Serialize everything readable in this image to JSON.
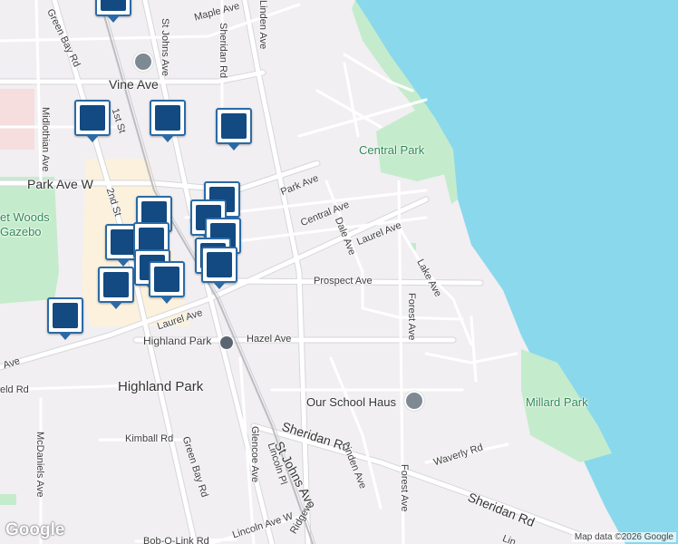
{
  "map": {
    "colors": {
      "land": "#f1eff2",
      "water": "#8ad8ec",
      "park": "#c4eccc",
      "road": "#ffffff",
      "road_edge": "#d6d6da",
      "rail": "#bcbcc2",
      "pin_border": "#2b6aa5",
      "pin_fill": "#134a82"
    },
    "streets": [
      "Green Bay Rd",
      "St Johns Ave",
      "Linden Ave",
      "Maple Ave",
      "Sheridan Rd",
      "Vine Ave",
      "Midlothian Ave",
      "1st St",
      "Park Ave W",
      "2nd St",
      "Park Ave",
      "Central Ave",
      "Dale Ave",
      "Laurel Ave",
      "Lake Ave",
      "Prospect Ave",
      "Forest Ave",
      "Laurel Ave",
      "Hazel Ave",
      "Ave",
      "eld Rd",
      "Kimball Rd",
      "Green Bay Rd",
      "Sheridan Rd",
      "St Johns Ave",
      "Glencoe Ave",
      "Lincoln Pl",
      "Linden Ave",
      "Forest Ave",
      "Waverly Rd",
      "Sheridan Rd",
      "McDaniels Ave",
      "Lincoln Ave W",
      "Ridgew",
      "Bob-O-Link Rd",
      "Lin"
    ],
    "places": {
      "city": "Highland Park",
      "station": "Highland Park",
      "poi": "Our School Haus",
      "park_central": "Central Park",
      "park_millard": "Millard Park",
      "park_west": "et Woods\nGazebo"
    },
    "pins": [
      "shopping-cart",
      "school",
      "school",
      "dining",
      "dining",
      "shopping",
      "coffee",
      "dining",
      "shopping-bag",
      "shopping",
      "coffee",
      "shopping-cart",
      "coffee",
      "coffee"
    ],
    "brand": "Google",
    "attribution": "Map data ©2026 Google"
  }
}
